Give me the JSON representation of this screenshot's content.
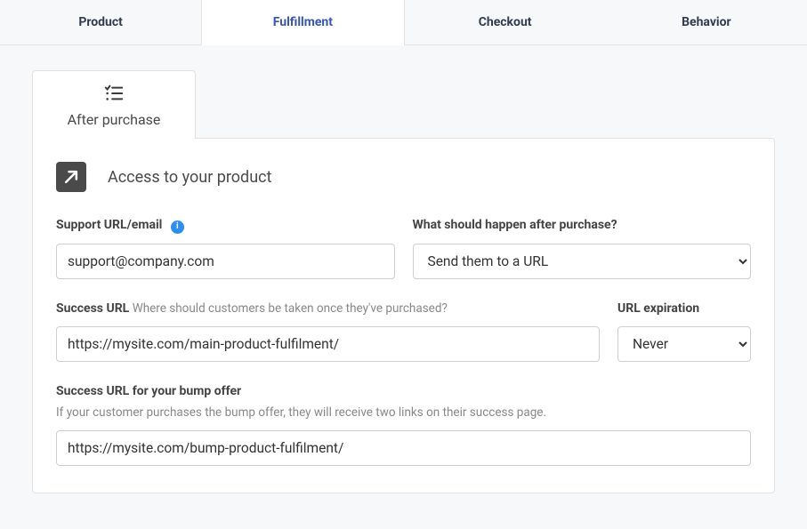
{
  "tabs": {
    "product": "Product",
    "fulfillment": "Fulfillment",
    "checkout": "Checkout",
    "behavior": "Behavior"
  },
  "subtab": {
    "after_purchase": "After purchase"
  },
  "section": {
    "title": "Access to your product"
  },
  "form": {
    "support": {
      "label": "Support URL/email",
      "value": "support@company.com"
    },
    "after_action": {
      "label": "What should happen after purchase?",
      "selected": "Send them to a URL"
    },
    "success_url": {
      "label": "Success URL",
      "hint": "Where should customers be taken once they've purchased?",
      "value": "https://mysite.com/main-product-fulfilment/"
    },
    "url_expiration": {
      "label": "URL expiration",
      "selected": "Never"
    },
    "bump_success": {
      "label": "Success URL for your bump offer",
      "hint": "If your customer purchases the bump offer, they will receive two links on their success page.",
      "value": "https://mysite.com/bump-product-fulfilment/"
    }
  }
}
